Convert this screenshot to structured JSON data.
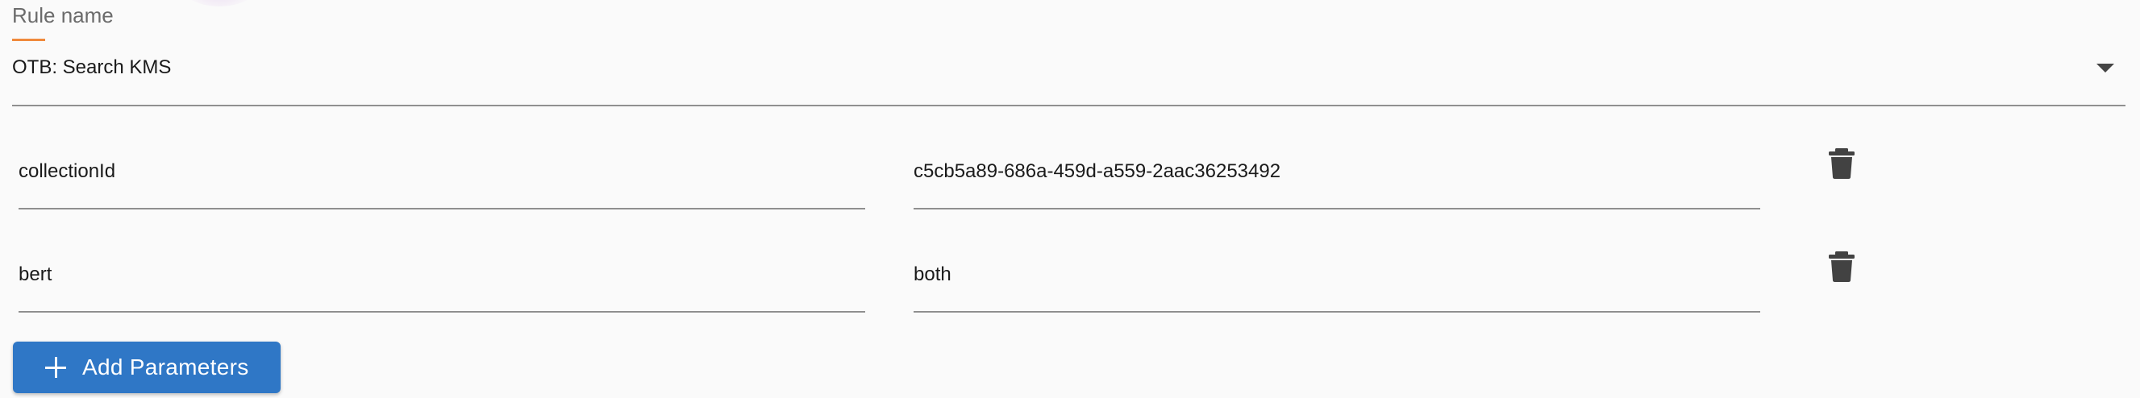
{
  "rule": {
    "label": "Rule name",
    "selected": "OTB: Search KMS"
  },
  "params": [
    {
      "name": "collectionId",
      "value": "c5cb5a89-686a-459d-a559-2aac36253492"
    },
    {
      "name": "bert",
      "value": "both"
    }
  ],
  "actions": {
    "add_parameters_label": "Add Parameters"
  },
  "colors": {
    "accent": "#f08a3c",
    "primary_button": "#2f77c6",
    "underline": "#8f8f8f"
  },
  "icons": {
    "delete": "trash-icon",
    "dropdown": "chevron-down-icon",
    "add": "plus-icon"
  }
}
